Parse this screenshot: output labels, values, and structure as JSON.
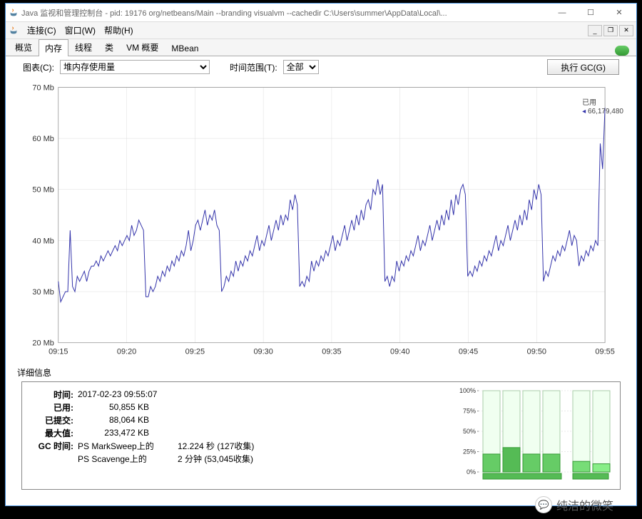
{
  "titlebar": {
    "title": "Java 监视和管理控制台 - pid: 19176 org/netbeans/Main --branding visualvm --cachedir C:\\Users\\summer\\AppData\\Local\\..."
  },
  "menu": {
    "connect": "连接(C)",
    "window": "窗口(W)",
    "help": "帮助(H)"
  },
  "tabs": {
    "overview": "概览",
    "memory": "内存",
    "threads": "线程",
    "classes": "类",
    "vm": "VM 概要",
    "mbean": "MBean"
  },
  "toolbar": {
    "chart_label": "图表(C):",
    "chart_select": "堆内存使用量",
    "time_label": "时间范围(T):",
    "time_select": "全部",
    "gc_button": "执行 GC(G)"
  },
  "chart_data": {
    "type": "line",
    "title": "",
    "xlabel": "",
    "ylabel": "Mb",
    "ylim": [
      20,
      70
    ],
    "yticks": [
      20,
      30,
      40,
      50,
      60,
      70
    ],
    "xticks": [
      "09:15",
      "09:20",
      "09:25",
      "09:30",
      "09:35",
      "09:40",
      "09:45",
      "09:50",
      "09:55"
    ],
    "annotation": {
      "label1": "已用",
      "label2": "66,179,480"
    },
    "series": [
      {
        "name": "已用",
        "color": "#3333aa",
        "values": [
          [
            0,
            32
          ],
          [
            1,
            28
          ],
          [
            2,
            29
          ],
          [
            3,
            30
          ],
          [
            4,
            30
          ],
          [
            5,
            42
          ],
          [
            6,
            31
          ],
          [
            7,
            30
          ],
          [
            8,
            33
          ],
          [
            9,
            32
          ],
          [
            10,
            33
          ],
          [
            11,
            34
          ],
          [
            12,
            32
          ],
          [
            13,
            34
          ],
          [
            14,
            35
          ],
          [
            15,
            35
          ],
          [
            16,
            36
          ],
          [
            17,
            35
          ],
          [
            18,
            37
          ],
          [
            19,
            36
          ],
          [
            20,
            37
          ],
          [
            21,
            38
          ],
          [
            22,
            37
          ],
          [
            23,
            38
          ],
          [
            24,
            39
          ],
          [
            25,
            38
          ],
          [
            26,
            40
          ],
          [
            27,
            39
          ],
          [
            28,
            40
          ],
          [
            29,
            41
          ],
          [
            30,
            40
          ],
          [
            31,
            43
          ],
          [
            32,
            41
          ],
          [
            33,
            42
          ],
          [
            34,
            44
          ],
          [
            35,
            43
          ],
          [
            36,
            42
          ],
          [
            37,
            29
          ],
          [
            38,
            29
          ],
          [
            39,
            31
          ],
          [
            40,
            30
          ],
          [
            41,
            31
          ],
          [
            42,
            33
          ],
          [
            43,
            32
          ],
          [
            44,
            34
          ],
          [
            45,
            33
          ],
          [
            46,
            35
          ],
          [
            47,
            34
          ],
          [
            48,
            36
          ],
          [
            49,
            35
          ],
          [
            50,
            37
          ],
          [
            51,
            36
          ],
          [
            52,
            38
          ],
          [
            53,
            37
          ],
          [
            54,
            39
          ],
          [
            55,
            42
          ],
          [
            56,
            38
          ],
          [
            57,
            40
          ],
          [
            58,
            43
          ],
          [
            59,
            44
          ],
          [
            60,
            42
          ],
          [
            61,
            44
          ],
          [
            62,
            46
          ],
          [
            63,
            43
          ],
          [
            64,
            45
          ],
          [
            65,
            44
          ],
          [
            66,
            46
          ],
          [
            67,
            43
          ],
          [
            68,
            42
          ],
          [
            69,
            30
          ],
          [
            70,
            31
          ],
          [
            71,
            33
          ],
          [
            72,
            32
          ],
          [
            73,
            34
          ],
          [
            74,
            33
          ],
          [
            75,
            36
          ],
          [
            76,
            34
          ],
          [
            77,
            36
          ],
          [
            78,
            35
          ],
          [
            79,
            37
          ],
          [
            80,
            36
          ],
          [
            81,
            38
          ],
          [
            82,
            37
          ],
          [
            83,
            39
          ],
          [
            84,
            41
          ],
          [
            85,
            38
          ],
          [
            86,
            40
          ],
          [
            87,
            39
          ],
          [
            88,
            41
          ],
          [
            89,
            43
          ],
          [
            90,
            40
          ],
          [
            91,
            42
          ],
          [
            92,
            44
          ],
          [
            93,
            42
          ],
          [
            94,
            45
          ],
          [
            95,
            43
          ],
          [
            96,
            45
          ],
          [
            97,
            44
          ],
          [
            98,
            48
          ],
          [
            99,
            46
          ],
          [
            100,
            49
          ],
          [
            101,
            47
          ],
          [
            102,
            31
          ],
          [
            103,
            32
          ],
          [
            104,
            31
          ],
          [
            105,
            33
          ],
          [
            106,
            32
          ],
          [
            107,
            36
          ],
          [
            108,
            34
          ],
          [
            109,
            36
          ],
          [
            110,
            35
          ],
          [
            111,
            37
          ],
          [
            112,
            36
          ],
          [
            113,
            38
          ],
          [
            114,
            37
          ],
          [
            115,
            39
          ],
          [
            116,
            41
          ],
          [
            117,
            38
          ],
          [
            118,
            40
          ],
          [
            119,
            39
          ],
          [
            120,
            41
          ],
          [
            121,
            43
          ],
          [
            122,
            40
          ],
          [
            123,
            42
          ],
          [
            124,
            44
          ],
          [
            125,
            42
          ],
          [
            126,
            45
          ],
          [
            127,
            43
          ],
          [
            128,
            46
          ],
          [
            129,
            44
          ],
          [
            130,
            47
          ],
          [
            131,
            48
          ],
          [
            132,
            46
          ],
          [
            133,
            50
          ],
          [
            134,
            49
          ],
          [
            135,
            52
          ],
          [
            136,
            49
          ],
          [
            137,
            51
          ],
          [
            138,
            32
          ],
          [
            139,
            33
          ],
          [
            140,
            31
          ],
          [
            141,
            33
          ],
          [
            142,
            32
          ],
          [
            143,
            36
          ],
          [
            144,
            34
          ],
          [
            145,
            36
          ],
          [
            146,
            35
          ],
          [
            147,
            37
          ],
          [
            148,
            36
          ],
          [
            149,
            38
          ],
          [
            150,
            37
          ],
          [
            151,
            39
          ],
          [
            152,
            41
          ],
          [
            153,
            38
          ],
          [
            154,
            40
          ],
          [
            155,
            39
          ],
          [
            156,
            41
          ],
          [
            157,
            43
          ],
          [
            158,
            40
          ],
          [
            159,
            42
          ],
          [
            160,
            44
          ],
          [
            161,
            42
          ],
          [
            162,
            45
          ],
          [
            163,
            43
          ],
          [
            164,
            46
          ],
          [
            165,
            44
          ],
          [
            166,
            48
          ],
          [
            167,
            45
          ],
          [
            168,
            49
          ],
          [
            169,
            47
          ],
          [
            170,
            50
          ],
          [
            171,
            51
          ],
          [
            172,
            49
          ],
          [
            173,
            33
          ],
          [
            174,
            34
          ],
          [
            175,
            33
          ],
          [
            176,
            35
          ],
          [
            177,
            34
          ],
          [
            178,
            36
          ],
          [
            179,
            35
          ],
          [
            180,
            37
          ],
          [
            181,
            36
          ],
          [
            182,
            38
          ],
          [
            183,
            37
          ],
          [
            184,
            39
          ],
          [
            185,
            41
          ],
          [
            186,
            38
          ],
          [
            187,
            40
          ],
          [
            188,
            39
          ],
          [
            189,
            41
          ],
          [
            190,
            43
          ],
          [
            191,
            40
          ],
          [
            192,
            42
          ],
          [
            193,
            44
          ],
          [
            194,
            42
          ],
          [
            195,
            45
          ],
          [
            196,
            43
          ],
          [
            197,
            46
          ],
          [
            198,
            44
          ],
          [
            199,
            48
          ],
          [
            200,
            46
          ],
          [
            201,
            50
          ],
          [
            202,
            48
          ],
          [
            203,
            51
          ],
          [
            204,
            49
          ],
          [
            205,
            32
          ],
          [
            206,
            34
          ],
          [
            207,
            33
          ],
          [
            208,
            35
          ],
          [
            209,
            37
          ],
          [
            210,
            36
          ],
          [
            211,
            38
          ],
          [
            212,
            37
          ],
          [
            213,
            39
          ],
          [
            214,
            38
          ],
          [
            215,
            40
          ],
          [
            216,
            42
          ],
          [
            217,
            39
          ],
          [
            218,
            41
          ],
          [
            219,
            40
          ],
          [
            220,
            35
          ],
          [
            221,
            37
          ],
          [
            222,
            36
          ],
          [
            223,
            38
          ],
          [
            224,
            37
          ],
          [
            225,
            39
          ],
          [
            226,
            38
          ],
          [
            227,
            40
          ],
          [
            228,
            39
          ],
          [
            229,
            59
          ],
          [
            230,
            54
          ],
          [
            231,
            66
          ]
        ]
      }
    ]
  },
  "details": {
    "section_label": "详细信息",
    "rows": {
      "time_k": "时间:",
      "time_v": "2017-02-23 09:55:07",
      "used_k": "已用:",
      "used_v": "50,855 KB",
      "committed_k": "已提交:",
      "committed_v": "88,064 KB",
      "max_k": "最大值:",
      "max_v": "233,472 KB",
      "gc_k": "GC 时间:",
      "gc1_name": "PS MarkSweep上的",
      "gc1_val": "12.224 秒 (127收集)",
      "gc2_name": "PS Scavenge上的",
      "gc2_val": "2 分钟 (53,045收集)"
    }
  },
  "mini": {
    "ticks": [
      "100%",
      "75%",
      "50%",
      "25%",
      "0%"
    ],
    "bars": [
      {
        "v": 22,
        "c": "#6c6"
      },
      {
        "v": 30,
        "c": "#5b5"
      },
      {
        "v": 22,
        "c": "#6c6"
      },
      {
        "v": 22,
        "c": "#6c6"
      },
      {
        "v": 13,
        "c": "#7d7"
      },
      {
        "v": 10,
        "c": "#8e8"
      }
    ]
  },
  "watermark": "纯洁的微笑"
}
